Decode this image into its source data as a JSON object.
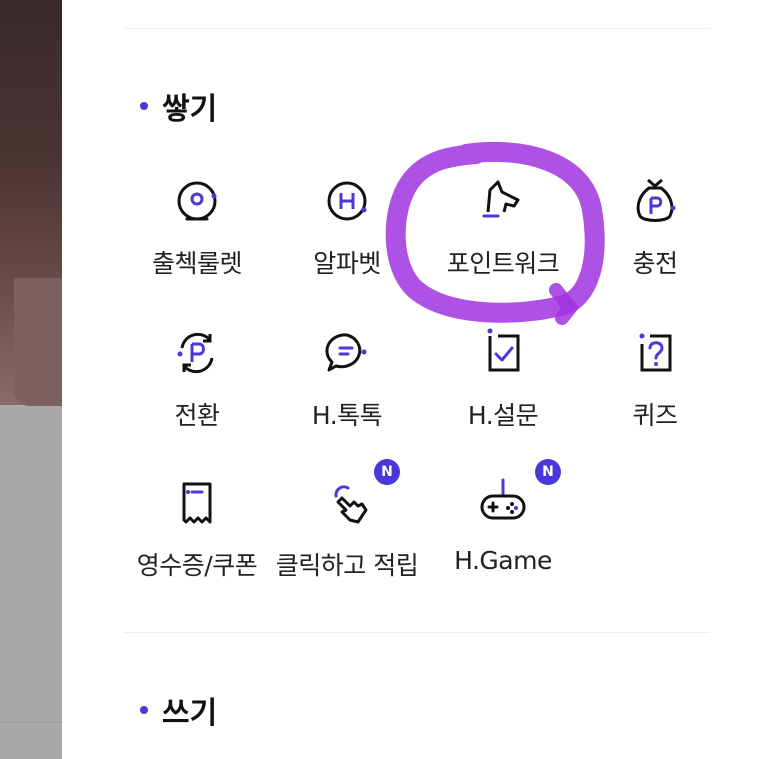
{
  "sections": {
    "earn": {
      "title": "쌓기"
    },
    "spend": {
      "title": "쓰기"
    }
  },
  "tiles": [
    {
      "label": "출첵룰렛",
      "icon": "roulette-icon"
    },
    {
      "label": "알파벳",
      "icon": "alphabet-h-icon"
    },
    {
      "label": "포인트워크",
      "icon": "dog-walk-icon"
    },
    {
      "label": "충전",
      "icon": "money-bag-icon"
    },
    {
      "label": "전환",
      "icon": "point-exchange-icon"
    },
    {
      "label": "H.톡톡",
      "icon": "chat-bubble-icon"
    },
    {
      "label": "H.설문",
      "icon": "survey-check-icon"
    },
    {
      "label": "퀴즈",
      "icon": "quiz-icon"
    },
    {
      "label": "영수증/쿠폰",
      "icon": "receipt-icon"
    },
    {
      "label": "클릭하고 적립",
      "icon": "click-hand-icon",
      "badge": "N"
    },
    {
      "label": "H.Game",
      "icon": "gamepad-icon",
      "badge": "N"
    }
  ],
  "colors": {
    "accent": "#4b38d8",
    "highlight": "#a033e0"
  }
}
